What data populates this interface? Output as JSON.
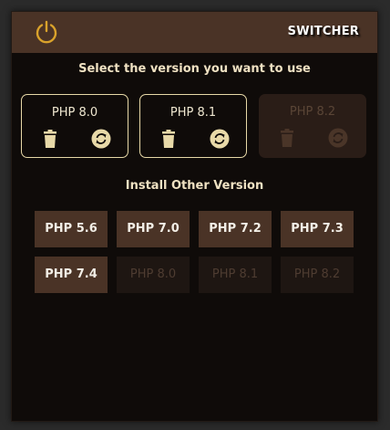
{
  "header": {
    "brand": "SWITCHER",
    "power_icon": "power-icon",
    "power_color": "#d9a22b"
  },
  "active": {
    "title": "Select the version you want to use",
    "cards": [
      {
        "label": "PHP 8.0",
        "enabled": true
      },
      {
        "label": "PHP 8.1",
        "enabled": true
      },
      {
        "label": "PHP 8.2",
        "enabled": false
      }
    ]
  },
  "install": {
    "title": "Install Other Version",
    "versions": [
      {
        "label": "PHP 5.6",
        "enabled": true
      },
      {
        "label": "PHP 7.0",
        "enabled": true
      },
      {
        "label": "PHP 7.2",
        "enabled": true
      },
      {
        "label": "PHP 7.3",
        "enabled": true
      },
      {
        "label": "PHP 7.4",
        "enabled": true
      },
      {
        "label": "PHP 8.0",
        "enabled": false
      },
      {
        "label": "PHP 8.1",
        "enabled": false
      },
      {
        "label": "PHP 8.2",
        "enabled": false
      }
    ]
  },
  "colors": {
    "background": "#0f0b09",
    "header": "#4a3326",
    "accent": "#e8d9a8"
  }
}
